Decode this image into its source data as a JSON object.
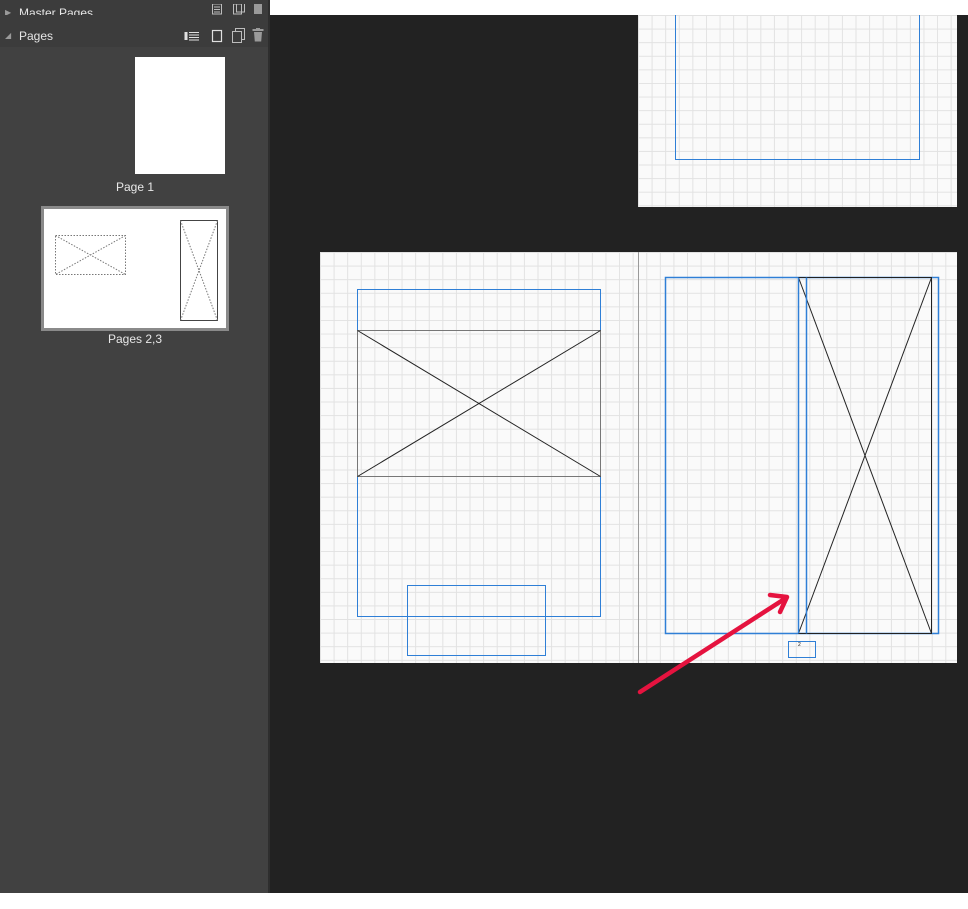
{
  "panel": {
    "master_pages_label": "Master Pages",
    "pages_label": "Pages"
  },
  "pages": [
    {
      "label": "Page 1"
    },
    {
      "label": "Pages 2,3"
    }
  ],
  "canvas": {
    "page_number_marker": "2"
  },
  "colors": {
    "sidebar": "#3c3c3c",
    "canvas_bg": "#222222",
    "frame_blue": "#2f7fd6",
    "annotation_arrow": "#e5133f",
    "selected_thumb_border": "#8a8a8a"
  },
  "icons": [
    "insert-page-icon",
    "new-page-icon",
    "duplicate-page-icon",
    "delete-page-icon",
    "master-options-icon"
  ]
}
